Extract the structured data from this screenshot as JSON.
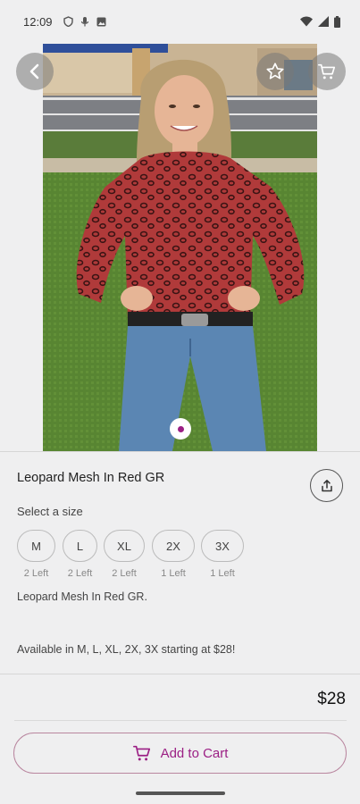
{
  "status_bar": {
    "time": "12:09",
    "left_icons": [
      "shield-icon",
      "mic-icon",
      "image-icon"
    ],
    "right_icons": [
      "wifi-icon",
      "signal-icon",
      "battery-icon"
    ]
  },
  "top_nav": {
    "back_icon": "chevron-left-icon",
    "favorite_icon": "star-outline-icon",
    "cart_icon": "cart-icon"
  },
  "gallery": {
    "image_description": "product-photo",
    "current_page": 1,
    "total_pages": 1
  },
  "product": {
    "title": "Leopard Mesh In Red GR",
    "share_icon": "share-icon",
    "size_prompt": "Select a size",
    "sizes": [
      {
        "label": "M",
        "stock": "2 Left"
      },
      {
        "label": "L",
        "stock": "2 Left"
      },
      {
        "label": "XL",
        "stock": "2 Left"
      },
      {
        "label": "2X",
        "stock": "1 Left"
      },
      {
        "label": "3X",
        "stock": "1 Left"
      }
    ],
    "description_line1": "Leopard Mesh In Red GR.",
    "description_line2": "Available in M, L, XL, 2X, 3X starting at $28!",
    "price": "$28"
  },
  "cart_button": {
    "label": "Add to Cart",
    "icon": "cart-icon"
  },
  "colors": {
    "accent": "#9b1f84",
    "background": "#efeff0"
  }
}
